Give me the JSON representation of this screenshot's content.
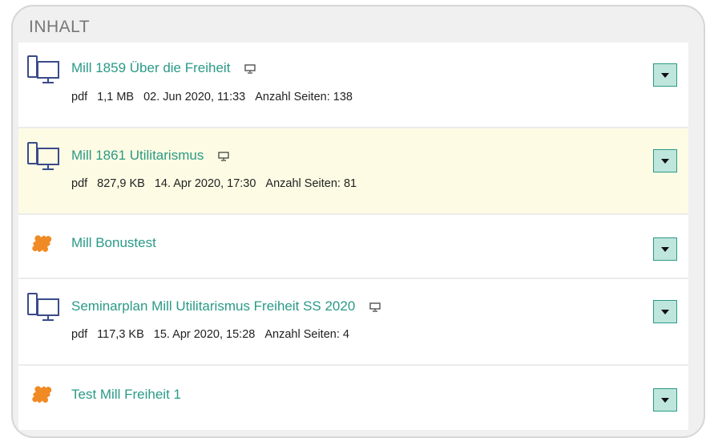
{
  "panel": {
    "title": "INHALT"
  },
  "items": [
    {
      "type": "document",
      "title": "Mill 1859 Über die Freiheit",
      "has_screen_icon": true,
      "format": "pdf",
      "size": "1,1 MB",
      "date": "02. Jun 2020, 11:33",
      "pages_label": "Anzahl Seiten: 138",
      "highlighted": false
    },
    {
      "type": "document",
      "title": "Mill 1861 Utilitarismus",
      "has_screen_icon": true,
      "format": "pdf",
      "size": "827,9 KB",
      "date": "14. Apr 2020, 17:30",
      "pages_label": "Anzahl Seiten: 81",
      "highlighted": true
    },
    {
      "type": "test",
      "title": "Mill Bonustest",
      "has_screen_icon": false,
      "highlighted": false
    },
    {
      "type": "document",
      "title": "Seminarplan Mill Utilitarismus Freiheit SS 2020",
      "has_screen_icon": true,
      "format": "pdf",
      "size": "117,3 KB",
      "date": "15. Apr 2020, 15:28",
      "pages_label": "Anzahl Seiten: 4",
      "highlighted": false
    },
    {
      "type": "test",
      "title": "Test Mill Freiheit 1",
      "has_screen_icon": false,
      "highlighted": false
    }
  ],
  "colors": {
    "link": "#2a9a88",
    "highlight": "#fdfbe3",
    "puzzle": "#f08a24",
    "doc_icon": "#3a4a8a",
    "dropdown_bg": "#bfe6dc"
  }
}
